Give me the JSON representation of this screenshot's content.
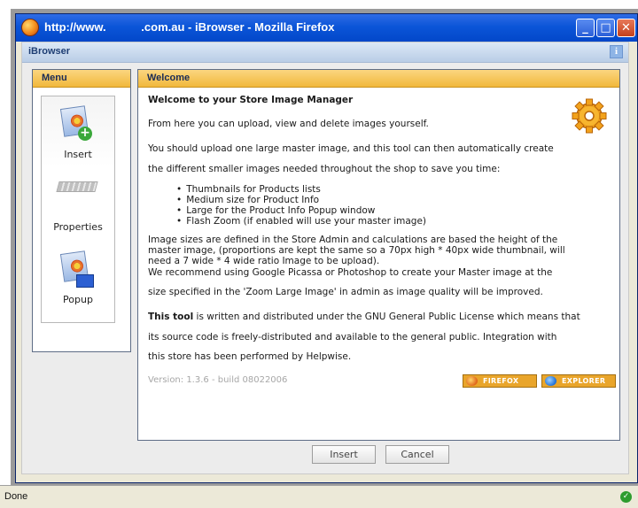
{
  "window": {
    "title": "http://www.           .com.au - iBrowser - Mozilla Firefox",
    "minimize_label": "_",
    "maximize_label": "□",
    "close_label": "✕"
  },
  "app": {
    "title": "iBrowser",
    "info_label": "i"
  },
  "menu": {
    "header": "Menu",
    "items": [
      {
        "label": "Insert",
        "icon": "insert-image-icon"
      },
      {
        "label": "Properties",
        "icon": "properties-icon"
      },
      {
        "label": "Popup",
        "icon": "popup-image-icon"
      }
    ]
  },
  "content": {
    "header": "Welcome",
    "heading": "Welcome to your Store Image Manager",
    "intro": "From here you can upload, view and delete images yourself.",
    "para1_line1": "You should upload one large master image, and this tool can then automatically create",
    "para1_line2": "the different smaller images needed throughout the shop to save you time:",
    "bullets": [
      "Thumbnails for Products lists",
      "Medium size for Product Info",
      "Large for the Product Info Popup window",
      "Flash Zoom (if enabled will use your master image)"
    ],
    "sizes_line1": "Image sizes are defined in the Store Admin and calculations are based the height of the",
    "sizes_line2": "master image, (proportions are kept the same so a 70px high * 40px wide thumbnail, will",
    "sizes_line3": "need a 7 wide * 4 wide ratio Image to be upload).",
    "recommend_line1": "We recommend using Google Picassa or Photoshop to create your Master image at the",
    "recommend_line2": "size specified in the 'Zoom Large Image' in admin as image quality will be improved.",
    "license_bold": "This tool",
    "license_line1_rest": " is written and distributed under the GNU General Public License which means that",
    "license_line2": "its source code is freely-distributed and available to the general public. Integration with",
    "license_line3": "this store has been performed by Helpwise.",
    "version": "Version: 1.3.6 - build 08022006",
    "firefox_badge": "FIREFOX",
    "explorer_badge": "EXPLORER"
  },
  "actions": {
    "insert": "Insert",
    "cancel": "Cancel"
  },
  "status": {
    "text": "Done"
  },
  "colors": {
    "titlebar": "#0b55d8",
    "panel_header": "#f1b83c",
    "badge": "#e9a52b"
  }
}
